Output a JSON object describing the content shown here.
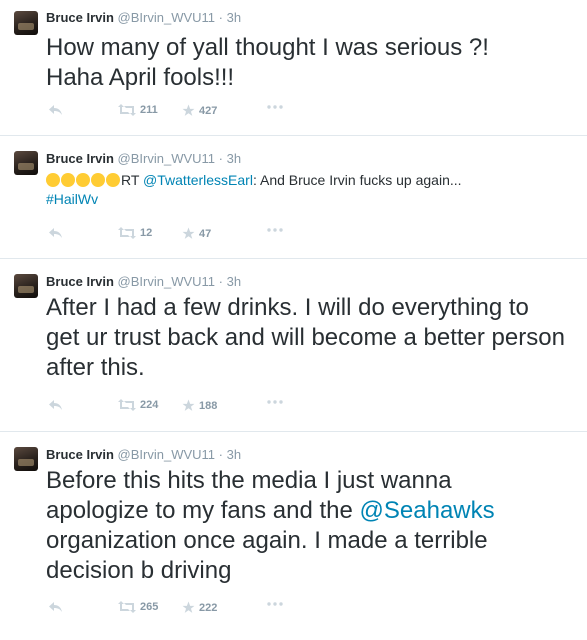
{
  "tweets": [
    {
      "name": "Bruce Irvin",
      "handle": "@BIrvin_WVU11",
      "time": "3h",
      "text": "How many of yall thought I was serious ?! Haha April fools!!!",
      "retweets": "211",
      "favorites": "427"
    },
    {
      "name": "Bruce Irvin",
      "handle": "@BIrvin_WVU11",
      "time": "3h",
      "emoji": [
        "face-with-tears-of-joy",
        "face-with-tears-of-joy",
        "face-with-tears-of-joy",
        "face-with-tears-of-joy",
        "face-with-tears-of-joy"
      ],
      "rt_prefix": "RT ",
      "mention": "@TwatterlessEarl",
      "text_after": ": And Bruce Irvin fucks up again...",
      "hashtag": "#HailWv",
      "retweets": "12",
      "favorites": "47"
    },
    {
      "name": "Bruce Irvin",
      "handle": "@BIrvin_WVU11",
      "time": "3h",
      "text": "After I had a few drinks. I will do everything to get ur trust back and will become a better person after this.",
      "retweets": "224",
      "favorites": "188"
    },
    {
      "name": "Bruce Irvin",
      "handle": "@BIrvin_WVU11",
      "time": "3h",
      "text_before": "Before this hits the media I just wanna apologize to my fans and the ",
      "mention": "@Seahawks",
      "text_after": " organization once again. I made a terrible decision b driving",
      "retweets": "265",
      "favorites": "222"
    }
  ],
  "icons": {
    "reply": "reply-arrow-icon",
    "retweet": "retweet-icon",
    "favorite": "star-icon",
    "more": "ellipsis-icon"
  },
  "colors": {
    "text": "#292f33",
    "muted": "#8899a6",
    "link": "#0084b4",
    "divider": "#e1e8ed"
  }
}
